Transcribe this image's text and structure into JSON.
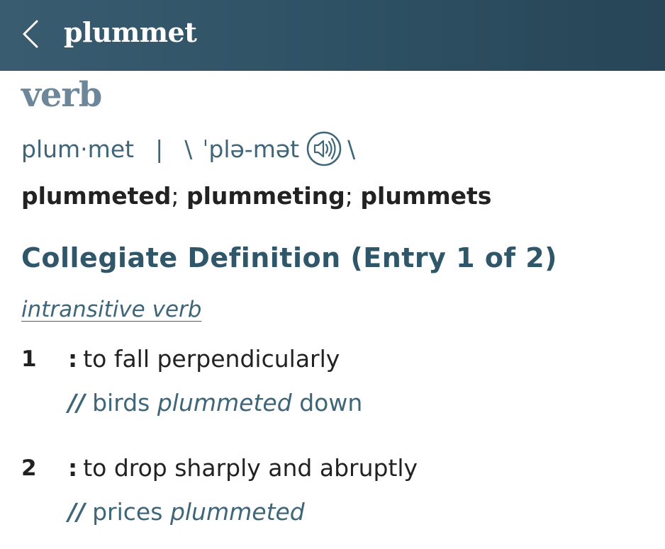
{
  "header": {
    "back_icon": "chevron-left-icon",
    "title": "plummet",
    "background": "#2e5063"
  },
  "entry": {
    "part_of_speech": "verb",
    "syllables": "plum·met",
    "separator": "|",
    "pron_open": "\\",
    "pronunciation": "ˈplə-mət",
    "audio_icon": "speaker-icon",
    "pron_close": "\\",
    "inflections": [
      {
        "word": "plummeted",
        "sep": ";"
      },
      {
        "word": "plummeting",
        "sep": ";"
      },
      {
        "word": "plummets",
        "sep": ""
      }
    ],
    "section_title": "Collegiate Definition (Entry 1 of 2)",
    "function_label": "intransitive verb",
    "senses": [
      {
        "number": "1",
        "colon": ":",
        "definition": "to fall perpendicularly",
        "example_marker": "//",
        "example_before": "birds",
        "example_word": "plummeted",
        "example_after": "down"
      },
      {
        "number": "2",
        "colon": ":",
        "definition": "to drop sharply and abruptly",
        "example_marker": "//",
        "example_before": "prices",
        "example_word": "plummeted",
        "example_after": ""
      }
    ]
  },
  "colors": {
    "accent": "#30566a",
    "link": "#3f6678",
    "pos_label": "#6b8799"
  }
}
